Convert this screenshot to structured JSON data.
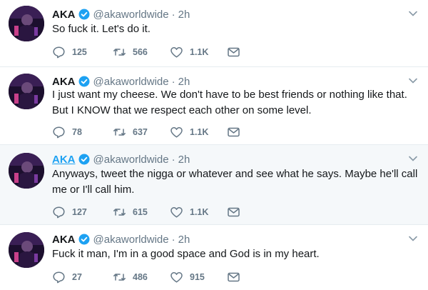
{
  "tweets": [
    {
      "name": "AKA",
      "handle": "@akaworldwide",
      "time": "2h",
      "text": "So fuck it. Let's do it.",
      "replies": "125",
      "retweets": "566",
      "likes": "1.1K",
      "highlighted": false
    },
    {
      "name": "AKA",
      "handle": "@akaworldwide",
      "time": "2h",
      "text": "I just want my cheese. We don't have to be best friends or nothing like that. But I KNOW that we respect each other on some level.",
      "replies": "78",
      "retweets": "637",
      "likes": "1.1K",
      "highlighted": false
    },
    {
      "name": "AKA",
      "handle": "@akaworldwide",
      "time": "2h",
      "text": "Anyways, tweet the nigga or whatever and see what he says. Maybe he'll call me or I'll call him.",
      "replies": "127",
      "retweets": "615",
      "likes": "1.1K",
      "highlighted": true
    },
    {
      "name": "AKA",
      "handle": "@akaworldwide",
      "time": "2h",
      "text": "Fuck it man, I'm in a good space and God is in my heart.",
      "replies": "27",
      "retweets": "486",
      "likes": "915",
      "highlighted": false
    }
  ],
  "icons": {
    "reply": "reply-icon",
    "retweet": "retweet-icon",
    "like": "heart-icon",
    "dm": "envelope-icon",
    "verified": "verified-badge-icon",
    "more": "chevron-down-icon"
  },
  "colors": {
    "verified": "#1da1f2",
    "icon": "#657786",
    "highlight_bg": "#f5f8fa",
    "separator": "#e6ecf0"
  }
}
